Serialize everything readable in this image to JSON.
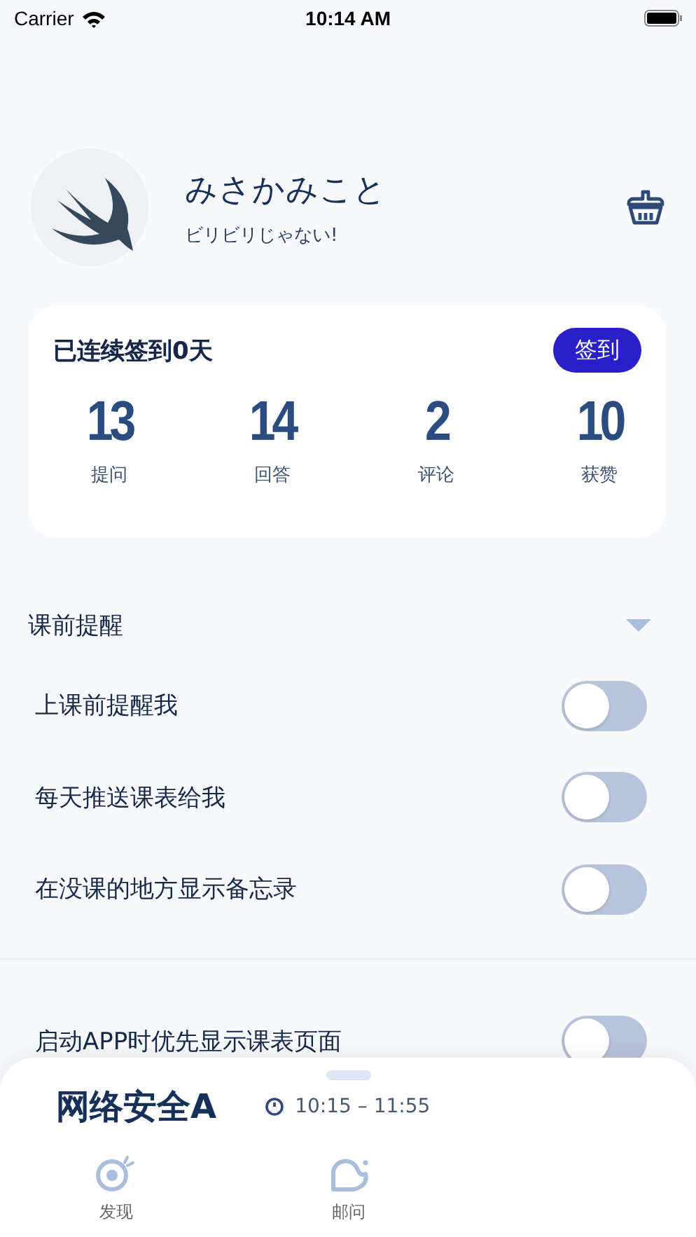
{
  "status_bar": {
    "carrier": "Carrier",
    "time": "10:14 AM"
  },
  "profile": {
    "name": "みさかみこと",
    "motto": "ビリビリじゃない!"
  },
  "checkin": {
    "title": "已连续签到0天",
    "button": "签到",
    "stats": [
      {
        "value": "13",
        "label": "提问"
      },
      {
        "value": "14",
        "label": "回答"
      },
      {
        "value": "2",
        "label": "评论"
      },
      {
        "value": "10",
        "label": "获赞"
      }
    ]
  },
  "section": {
    "title": "课前提醒",
    "expanded": true
  },
  "settings": [
    {
      "label": "上课前提醒我",
      "on": false
    },
    {
      "label": "每天推送课表给我",
      "on": false
    },
    {
      "label": "在没课的地方显示备忘录",
      "on": false
    },
    {
      "label": "启动APP时优先显示课表页面",
      "on": false
    }
  ],
  "course_sheet": {
    "course": "网络安全A",
    "time": "10:15 – 11:55"
  },
  "tab_bar": [
    {
      "label": "发现",
      "kind": "discover"
    },
    {
      "label": "邮问",
      "kind": "ask"
    }
  ]
}
